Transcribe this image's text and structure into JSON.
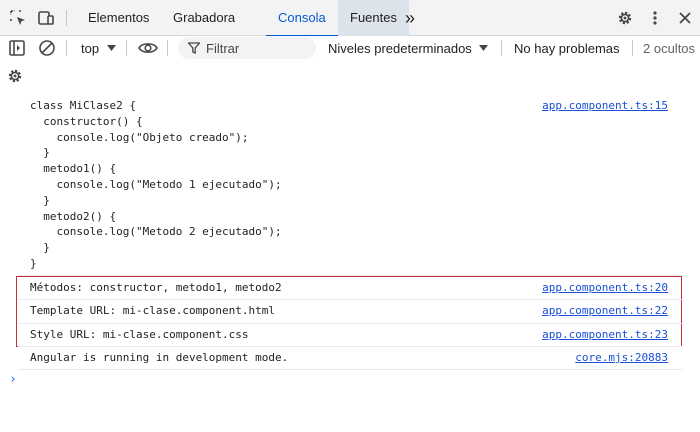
{
  "tabs": [
    {
      "label": "Elementos"
    },
    {
      "label": "Grabadora"
    },
    {
      "label": "Consola"
    },
    {
      "label": "Fuentes"
    }
  ],
  "more_tabs_glyph": "»",
  "toolbar": {
    "context": "top",
    "filter_placeholder": "Filtrar",
    "levels": "Niveles predeterminados",
    "issues": "No hay problemas",
    "hidden": "2 ocultos"
  },
  "icons": {
    "inspect": "inspect-element-icon",
    "device": "device-toolbar-icon",
    "sidebar": "sidebar-toggle-icon",
    "clear": "clear-console-icon",
    "eye": "live-expression-eye-icon",
    "filter": "filter-funnel-icon",
    "gear": "gear-icon",
    "kebab": "more-options-icon",
    "close": "close-icon"
  },
  "console": {
    "code_lines": [
      "class MiClase2 {",
      "  constructor() {",
      "    console.log(\"Objeto creado\");",
      "  }",
      "  metodo1() {",
      "    console.log(\"Metodo 1 ejecutado\");",
      "  }",
      "  metodo2() {",
      "    console.log(\"Metodo 2 ejecutado\");",
      "  }",
      "}"
    ],
    "code_source": "app.component.ts:15",
    "messages": [
      {
        "text": "Métodos: constructor, metodo1, metodo2",
        "source": "app.component.ts:20"
      },
      {
        "text": "Template URL: mi-clase.component.html",
        "source": "app.component.ts:22"
      },
      {
        "text": "Style URL: mi-clase.component.css",
        "source": "app.component.ts:23"
      },
      {
        "text": "Angular is running in development mode.",
        "source": "core.mjs:20883"
      }
    ],
    "prompt": "›"
  },
  "colors": {
    "accent": "#0b57d0",
    "link": "#1a4fd6",
    "highlight_border": "#c9303e"
  }
}
